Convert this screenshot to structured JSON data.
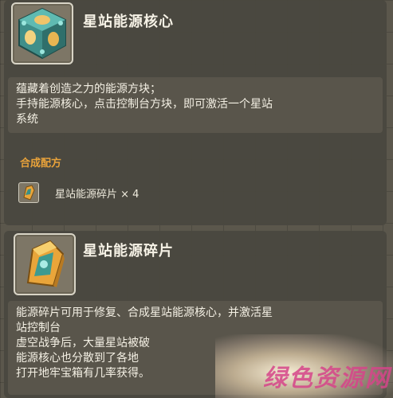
{
  "core_item": {
    "name": "星站能源核心",
    "icon": "energy-core-cube-icon",
    "description": [
      "蕴藏着创造之力的能源方块；",
      "手持能源核心，点击控制台方块，即可激活一个星站",
      "系统"
    ],
    "recipe_title": "合成配方",
    "recipe_items": [
      {
        "icon": "energy-fragment-icon",
        "label": "星站能源碎片 × 4"
      }
    ]
  },
  "fragment_item": {
    "name": "星站能源碎片",
    "icon": "energy-fragment-icon",
    "description": [
      "能源碎片可用于修复、合成星站能源核心，并激活星",
      "站控制台",
      "虚空战争后，大量星站被破",
      "能源核心也分散到了各地",
      "打开地牢宝箱有几率获得。"
    ]
  },
  "watermark_text": "绿色资源网"
}
